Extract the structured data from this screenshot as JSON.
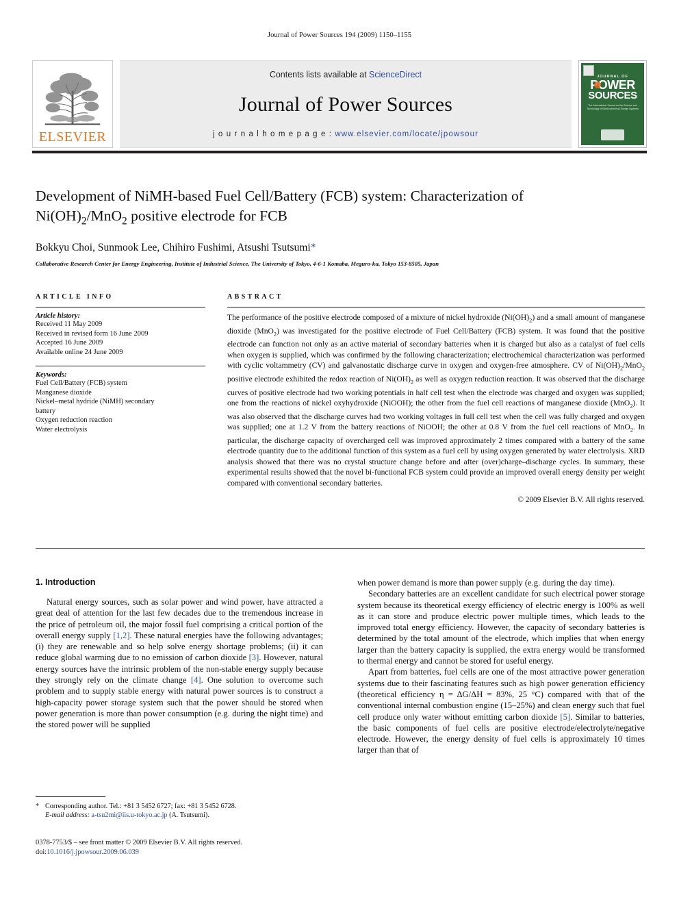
{
  "running_head": "Journal of Power Sources 194 (2009) 1150–1155",
  "masthead": {
    "contents_prefix": "Contents lists available at ",
    "sciencedirect": "ScienceDirect",
    "journal_title": "Journal of Power Sources",
    "homepage_prefix": "j o u r n a l   h o m e p a g e :   ",
    "homepage_url": "www.elsevier.com/locate/jpowsour",
    "elsevier_word": "ELSEVIER",
    "cover": {
      "journal_of": "JOURNAL OF",
      "power": "POWER",
      "sources": "SOURCES",
      "subtitle": "The International Journal on the Science and Technology of Electro­chemical Energy Systems"
    },
    "accent_blue": "#2f4da0",
    "elsevier_orange": "#e87722",
    "cover_green": "#2f6b3a"
  },
  "article": {
    "title_line1": "Development of NiMH-based Fuel Cell/Battery (FCB) system: Characterization of",
    "title_line2_a": "Ni(OH)",
    "title_line2_sub1": "2",
    "title_line2_b": "/MnO",
    "title_line2_sub2": "2",
    "title_line2_c": " positive electrode for FCB",
    "authors": "Bokkyu Choi, Sunmook Lee, Chihiro Fushimi, Atsushi Tsutsumi",
    "author_star": "*",
    "affiliation": "Collaborative Research Center for Energy Engineering, Institute of Industrial Science, The University of Tokyo, 4-6-1 Komaba, Meguro-ku, Tokyo 153-8505, Japan"
  },
  "article_info": {
    "heading": "ARTICLE INFO",
    "history_label": "Article history:",
    "history": [
      "Received 11 May 2009",
      "Received in revised form 16 June 2009",
      "Accepted 16 June 2009",
      "Available online 24 June 2009"
    ],
    "keywords_label": "Keywords:",
    "keywords": [
      "Fuel Cell/Battery (FCB) system",
      "Manganese dioxide",
      "Nickel–metal hydride (NiMH) secondary",
      "battery",
      "Oxygen reduction reaction",
      "Water electrolysis"
    ]
  },
  "abstract": {
    "heading": "ABSTRACT",
    "text": "The performance of the positive electrode composed of a mixture of nickel hydroxide (Ni(OH)2) and a small amount of manganese dioxide (MnO2) was investigated for the positive electrode of Fuel Cell/Battery (FCB) system. It was found that the positive electrode can function not only as an active material of secondary batteries when it is charged but also as a catalyst of fuel cells when oxygen is supplied, which was confirmed by the following characterization; electrochemical characterization was performed with cyclic voltammetry (CV) and galvanostatic discharge curve in oxygen and oxygen-free atmosphere. CV of Ni(OH)2/MnO2 positive electrode exhibited the redox reaction of Ni(OH)2 as well as oxygen reduction reaction. It was observed that the discharge curves of positive electrode had two working potentials in half cell test when the electrode was charged and oxygen was supplied; one from the reactions of nickel oxyhydroxide (NiOOH); the other from the fuel cell reactions of manganese dioxide (MnO2). It was also observed that the discharge curves had two working voltages in full cell test when the cell was fully charged and oxygen was supplied; one at 1.2 V from the battery reactions of NiOOH; the other at 0.8 V from the fuel cell reactions of MnO2. In particular, the discharge capacity of overcharged cell was improved approximately 2 times compared with a battery of the same electrode quantity due to the additional function of this system as a fuel cell by using oxygen generated by water electrolysis. XRD analysis showed that there was no crystal structure change before and after (over)charge–discharge cycles. In summary, these experimental results showed that the novel bi-functional FCB system could provide an improved overall energy density per weight compared with conventional secondary batteries.",
    "copyright": "© 2009 Elsevier B.V. All rights reserved."
  },
  "introduction": {
    "section_title": "1. Introduction",
    "left_paragraph": "Natural energy sources, such as solar power and wind power, have attracted a great deal of attention for the last few decades due to the tremendous increase in the price of petroleum oil, the major fossil fuel comprising a critical portion of the overall energy supply [1,2]. These natural energies have the following advantages; (i) they are renewable and so help solve energy shortage problems; (ii) it can reduce global warming due to no emission of carbon dioxide [3]. However, natural energy sources have the intrinsic problem of the non-stable energy supply because they strongly rely on the climate change [4]. One solution to overcome such problem and to supply stable energy with natural power sources is to construct a high-capacity power storage system such that the power should be stored when power generation is more than power consumption (e.g. during the night time) and the stored power will be supplied",
    "right_paragraph_cont": "when power demand is more than power supply (e.g. during the day time).",
    "right_paragraph_2": "Secondary batteries are an excellent candidate for such electrical power storage system because its theoretical exergy efficiency of electric energy is 100% as well as it can store and produce electric power multiple times, which leads to the improved total energy efficiency. However, the capacity of secondary batteries is determined by the total amount of the electrode, which implies that when energy larger than the battery capacity is supplied, the extra energy would be transformed to thermal energy and cannot be stored for useful energy.",
    "right_paragraph_3": "Apart from batteries, fuel cells are one of the most attractive power generation systems due to their fascinating features such as high power generation efficiency (theoretical efficiency η = ΔG/ΔH = 83%, 25 °C) compared with that of the conventional internal combustion engine (15–25%) and clean energy such that fuel cell produce only water without emitting carbon dioxide [5]. Similar to batteries, the basic components of fuel cells are positive electrode/electrolyte/negative electrode. However, the energy density of fuel cells is approximately 10 times larger than that of"
  },
  "footnote": {
    "star": "*",
    "corresponding": "Corresponding author. Tel.: +81 3 5452 6727; fax: +81 3 5452 6728.",
    "email_label": "E-mail address:",
    "email": "a-tsu2mi@iis.u-tokyo.ac.jp",
    "email_suffix": "(A. Tsutsumi).",
    "issn_line": "0378-7753/$ – see front matter © 2009 Elsevier B.V. All rights reserved.",
    "doi_label": "doi:",
    "doi": "10.1016/j.jpowsour.2009.06.039"
  }
}
